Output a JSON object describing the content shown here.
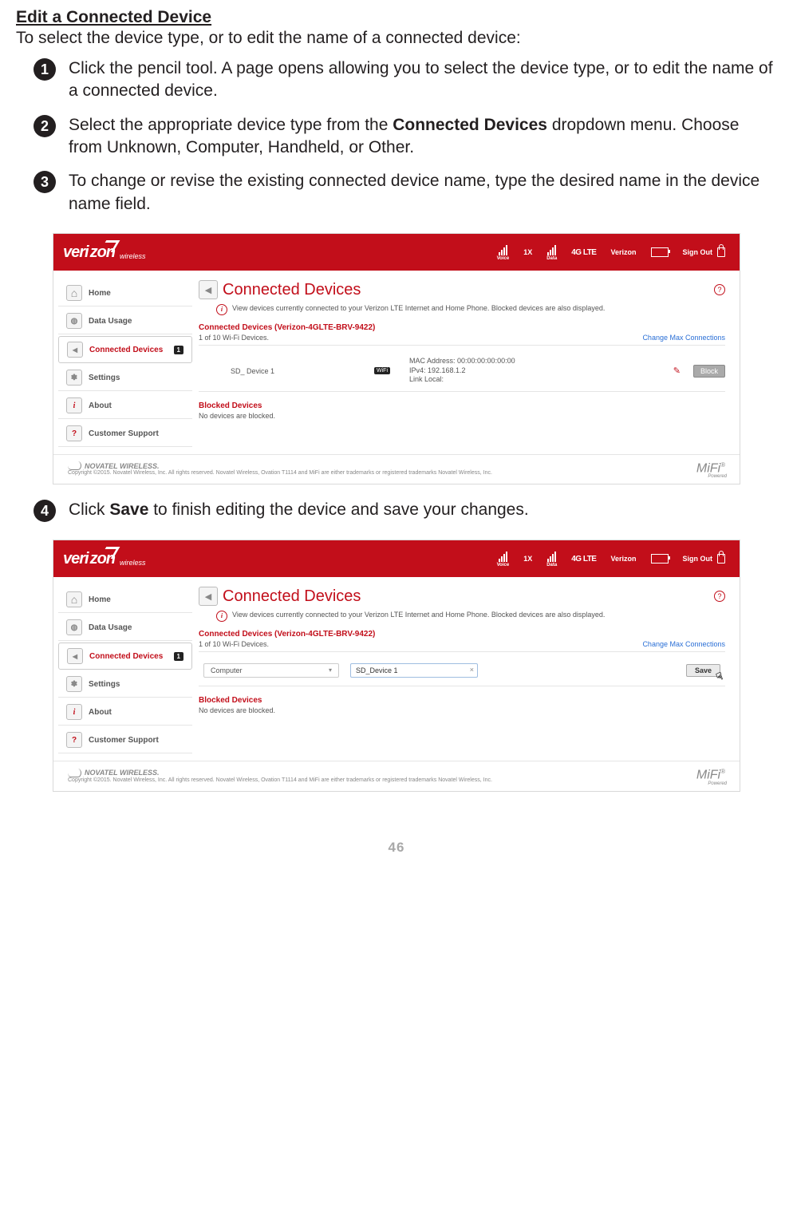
{
  "section_title": "Edit a Connected Device",
  "intro": "To select the device type, or to edit the name of a connected device:",
  "steps": {
    "s1_a": "Click the pencil tool. A page opens allowing you to select the device type, or to edit the name of a connected device.",
    "s2_a": "Select the appropriate device type from the ",
    "s2_b": "Connected Devices",
    "s2_c": " dropdown menu. Choose from Unknown, Computer, Handheld, or Other.",
    "s3_a": "To change or revise the existing connected device name, type the desired name in the device name field.",
    "s4_a": "Click ",
    "s4_b": "Save",
    "s4_c": " to finish editing the device and save your changes."
  },
  "shot": {
    "logo_veri": "veri",
    "logo_zon": "zon",
    "logo_wire": "wireless",
    "status_voice": "Voice",
    "status_1x": "1X",
    "status_data": "Data",
    "status_4g": "4G LTE",
    "carrier": "Verizon",
    "signout": "Sign Out",
    "nav_home": "Home",
    "nav_data": "Data Usage",
    "nav_conn": "Connected Devices",
    "nav_conn_badge": "1",
    "nav_settings": "Settings",
    "nav_about": "About",
    "nav_support": "Customer Support",
    "title": "Connected Devices",
    "info": "View devices currently connected to your Verizon LTE Internet and Home Phone. Blocked devices are also displayed.",
    "subtitle": "Connected Devices (Verizon-4GLTE-BRV-9422)",
    "count": "1 of 10 Wi-Fi Devices.",
    "change_link": "Change Max Connections",
    "dev_name": "SD_ Device 1",
    "wifi": "WiFi",
    "mac_label": "MAC Address:  00:00:00:00:00:00",
    "ipv4": "IPv4: 192.168.1.2",
    "linklocal": "Link Local:",
    "block": "Block",
    "blocked_title": "Blocked Devices",
    "blocked_text": "No devices are blocked.",
    "novatel": "NOVATEL WIRELESS.",
    "copyright": "Copyright ©2015. Novatel Wireless, Inc. All rights reserved. Novatel Wireless, Ovation T1114 and MiFi are either trademarks or registered trademarks Novatel Wireless, Inc.",
    "mifi": "MiFi",
    "mifi_reg": "®",
    "mifi_pow": "Powered",
    "dd_value": "Computer",
    "txt_value": "SD_Device 1",
    "save": "Save"
  },
  "page_number": "46"
}
